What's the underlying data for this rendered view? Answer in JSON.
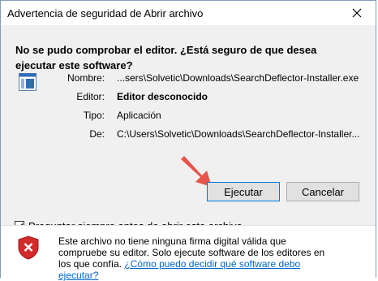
{
  "window": {
    "title": "Advertencia de seguridad de Abrir archivo"
  },
  "question": "No se pudo comprobar el editor. ¿Está seguro de que desea ejecutar este software?",
  "details": [
    {
      "label": "Nombre:",
      "value": "...sers\\Solvetic\\Downloads\\SearchDeflector-Installer.exe",
      "bold": false
    },
    {
      "label": "Editor:",
      "value": "Editor desconocido",
      "bold": true
    },
    {
      "label": "Tipo:",
      "value": "Aplicación",
      "bold": false
    },
    {
      "label": "De:",
      "value": "C:\\Users\\Solvetic\\Downloads\\SearchDeflector-Installer...",
      "bold": false
    }
  ],
  "buttons": {
    "run": "Ejecutar",
    "cancel": "Cancelar"
  },
  "checkbox": {
    "label": "Preguntar siempre antes de abrir este archivo",
    "checked": true
  },
  "footer": {
    "text": "Este archivo no tiene ninguna firma digital válida que compruebe su editor. Solo ejecute software de los editores en los que confía.",
    "link": "¿Cómo puedo decidir qué software debo ejecutar?"
  },
  "colors": {
    "arrow": "#e8544a",
    "shield": "#d22b2b",
    "link": "#0066cc"
  }
}
